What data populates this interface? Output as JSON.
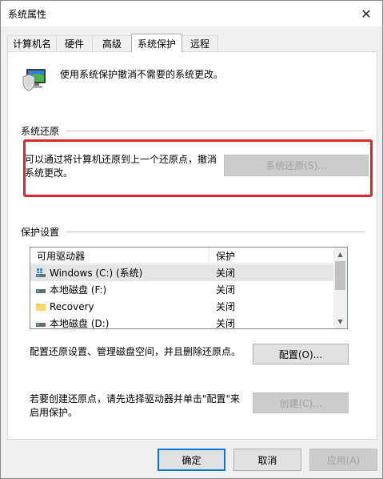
{
  "window": {
    "title": "系统属性",
    "close_glyph": "✕"
  },
  "tabs": [
    {
      "label": "计算机名",
      "active": false
    },
    {
      "label": "硬件",
      "active": false
    },
    {
      "label": "高级",
      "active": false
    },
    {
      "label": "系统保护",
      "active": true
    },
    {
      "label": "远程",
      "active": false
    }
  ],
  "intro": {
    "text": "使用系统保护撤消不需要的系统更改。",
    "icon": "computer-shield-icon"
  },
  "restore": {
    "group_label": "系统还原",
    "text": "可以通过将计算机还原到上一个还原点，撤消系统更改。",
    "button_label": "系统还原(S)...",
    "highlight_color": "#e0252b"
  },
  "protection": {
    "group_label": "保护设置",
    "columns": [
      "可用驱动器",
      "保护"
    ],
    "drives": [
      {
        "name": "Windows (C:) (系统)",
        "status": "关闭",
        "icon": "system-drive-icon",
        "selected": true
      },
      {
        "name": "本地磁盘 (F:)",
        "status": "关闭",
        "icon": "disk-drive-icon",
        "selected": false
      },
      {
        "name": "Recovery",
        "status": "关闭",
        "icon": "folder-icon",
        "selected": false
      },
      {
        "name": "本地磁盘 (D:)",
        "status": "关闭",
        "icon": "disk-drive-icon",
        "selected": false
      }
    ],
    "configure_text": "配置还原设置、管理磁盘空间，并且删除还原点。",
    "configure_button": "配置(O)...",
    "create_text": "若要创建还原点，请先选择驱动器并单击\"配置\"来启用保护。",
    "create_button": "创建(C)..."
  },
  "footer": {
    "ok": "确定",
    "cancel": "取消",
    "apply": "应用(A)"
  },
  "colors": {
    "accent": "#0078d7",
    "panel_bg": "#ffffff",
    "window_bg": "#f0f0f0"
  }
}
